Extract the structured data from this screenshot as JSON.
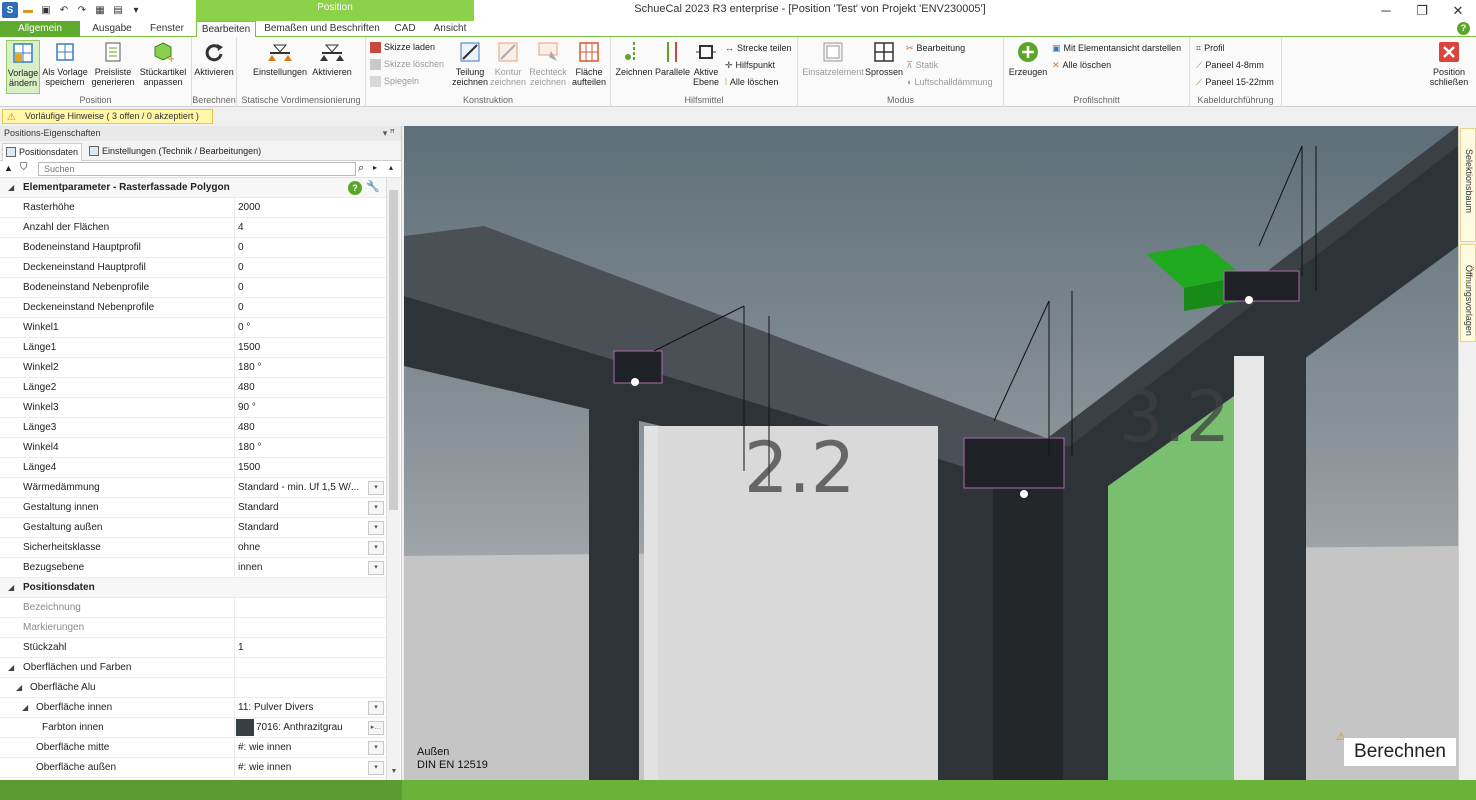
{
  "window": {
    "title": "SchueCal 2023 R3 enterprise - [Position 'Test' von Projekt 'ENV230005']",
    "context_tab_header": "Position",
    "minimize": "─",
    "restore": "❐",
    "close": "✕",
    "help": "?"
  },
  "tabs": {
    "file": "Allgemein",
    "ausgabe": "Ausgabe",
    "fenster": "Fenster",
    "bearbeiten": "Bearbeiten",
    "bemassen": "Bemaßen und Beschriften",
    "cad": "CAD",
    "ansicht": "Ansicht"
  },
  "ribbon": {
    "position": {
      "label": "Position",
      "vorlage_aendern": [
        "Vorlage",
        "ändern"
      ],
      "als_vorlage": [
        "Als Vorlage",
        "speichern"
      ],
      "preisliste": [
        "Preisliste",
        "generieren"
      ],
      "stueckartikel": [
        "Stückartikel",
        "anpassen"
      ]
    },
    "berechnen": {
      "label": "Berechnen",
      "aktivieren": "Aktivieren"
    },
    "statik": {
      "label": "Statische Vordimensionierung",
      "einstellungen": "Einstellungen",
      "aktivieren": "Aktivieren"
    },
    "konstruktion": {
      "label": "Konstruktion",
      "skizze_laden": "Skizze laden",
      "skizze_loeschen": "Skizze löschen",
      "spiegeln": "Spiegeln",
      "teilung": [
        "Teilung",
        "zeichnen"
      ],
      "kontur": [
        "Kontur",
        "zeichnen"
      ],
      "rechteck": [
        "Rechteck",
        "zeichnen"
      ],
      "flaeche": [
        "Fläche",
        "aufteilen"
      ]
    },
    "hilfsmittel": {
      "label": "Hilfsmittel",
      "zeichnen": "Zeichnen",
      "parallele": "Parallele",
      "aktive_ebene": [
        "Aktive",
        "Ebene"
      ],
      "strecke_teilen": "Strecke teilen",
      "hilfspunkt": "Hilfspunkt",
      "alle_loeschen": "Alle löschen"
    },
    "modus": {
      "label": "Modus",
      "einsatzelement": "Einsatzelement",
      "sprossen": "Sprossen",
      "bearbeitung": "Bearbeitung",
      "statik": "Statik",
      "luftschall": "Luftschalldämmung"
    },
    "profilschnitt": {
      "label": "Profilschnitt",
      "erzeugen": "Erzeugen",
      "elementansicht": "Mit Elementansicht darstellen",
      "alle_loeschen": "Alle löschen"
    },
    "kabel": {
      "label": "Kabeldurchführung",
      "profil": "Profil",
      "paneel1": "Paneel 4-8mm",
      "paneel2": "Paneel 15-22mm"
    },
    "schliessen": [
      "Position",
      "schließen"
    ]
  },
  "hint": "Vorläufige Hinweise ( 3 offen / 0 akzeptiert )",
  "panel": {
    "title": "Positions-Eigenschaften",
    "pin": "▾ ꟸ",
    "tab1": "Positionsdaten",
    "tab2": "Einstellungen (Technik / Bearbeitungen)",
    "search_placeholder": "Suchen",
    "rows": [
      {
        "type": "cat",
        "label": "Elementparameter - Rasterfassade Polygon",
        "value": ""
      },
      {
        "label": "Rasterhöhe",
        "value": "2000"
      },
      {
        "label": "Anzahl der Flächen",
        "value": "4"
      },
      {
        "label": "Bodeneinstand Hauptprofil",
        "value": "0"
      },
      {
        "label": "Deckeneinstand Hauptprofil",
        "value": "0"
      },
      {
        "label": "Bodeneinstand Nebenprofile",
        "value": "0"
      },
      {
        "label": "Deckeneinstand Nebenprofile",
        "value": "0"
      },
      {
        "label": "Winkel1",
        "value": "0 °"
      },
      {
        "label": "Länge1",
        "value": "1500"
      },
      {
        "label": "Winkel2",
        "value": "180 °"
      },
      {
        "label": "Länge2",
        "value": "480"
      },
      {
        "label": "Winkel3",
        "value": "90 °"
      },
      {
        "label": "Länge3",
        "value": "480"
      },
      {
        "label": "Winkel4",
        "value": "180 °"
      },
      {
        "label": "Länge4",
        "value": "1500"
      },
      {
        "label": "Wärmedämmung",
        "value": "Standard - min. Uf 1,5 W/...",
        "dd": true
      },
      {
        "label": "Gestaltung innen",
        "value": "Standard",
        "dd": true
      },
      {
        "label": "Gestaltung außen",
        "value": "Standard",
        "dd": true
      },
      {
        "label": "Sicherheitsklasse",
        "value": "ohne",
        "dd": true
      },
      {
        "label": "Bezugsebene",
        "value": "innen",
        "dd": true
      },
      {
        "type": "cat",
        "label": "Positionsdaten",
        "value": ""
      },
      {
        "label": "Bezeichnung",
        "value": "",
        "dim": true
      },
      {
        "label": "Markierungen",
        "value": "",
        "dim": true
      },
      {
        "label": "Stückzahl",
        "value": "1"
      },
      {
        "type": "sub",
        "label": "Oberflächen und Farben",
        "value": ""
      },
      {
        "type": "sub2",
        "label": "Oberfläche Alu",
        "value": ""
      },
      {
        "type": "sub3",
        "label": "Oberfläche innen",
        "value": "11: Pulver Divers",
        "dd": true
      },
      {
        "type": "leaf",
        "label": "Farbton innen",
        "value": "7016: Anthrazitgrau",
        "swatch": "#373f43",
        "more": true
      },
      {
        "type": "leaf2",
        "label": "Oberfläche mitte",
        "value": "#: wie innen",
        "dd": true
      },
      {
        "type": "leaf2",
        "label": "Oberfläche außen",
        "value": "#: wie innen",
        "dd": true
      }
    ]
  },
  "viewport": {
    "label_line1": "Außen",
    "label_line2": "DIN EN 12519",
    "mark1": "2.2",
    "mark2": "3.2",
    "calc_button": "Berechnen"
  },
  "side_tabs": {
    "tab1": "Selektionsbaum",
    "tab2": "Öffnungsvorlagen"
  },
  "colors": {
    "accent_green": "#6ab23a",
    "frame_dark": "#2e3337",
    "selection_green": "#1faa1f",
    "panel_green": "#7abf6f",
    "swatch_anthrazit": "#373f43"
  }
}
